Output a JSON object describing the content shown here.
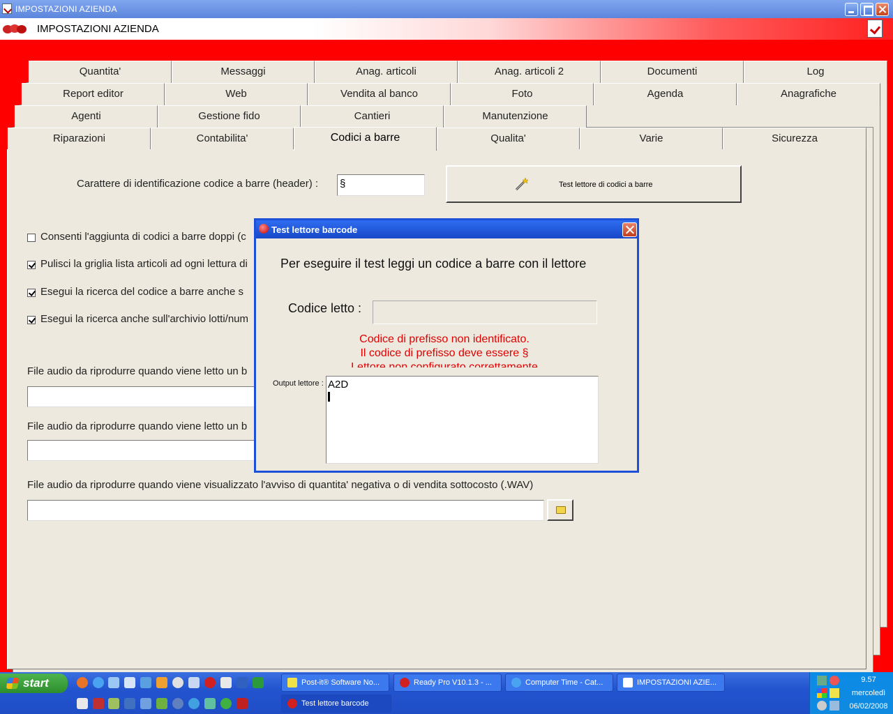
{
  "window": {
    "title": "IMPOSTAZIONI AZIENDA"
  },
  "header": {
    "title": "IMPOSTAZIONI AZIENDA"
  },
  "tabs": {
    "row1": [
      "Quantita'",
      "Messaggi",
      "Anag. articoli",
      "Anag. articoli 2",
      "Documenti",
      "Log"
    ],
    "row2": [
      "Report editor",
      "Web",
      "Vendita al banco",
      "Foto",
      "Agenda",
      "Anagrafiche"
    ],
    "row3": [
      "Agenti",
      "Gestione fido",
      "Cantieri",
      "Manutenzione"
    ],
    "row4": [
      "Riparazioni",
      "Contabilita'",
      "Codici a barre",
      "Qualita'",
      "Varie",
      "Sicurezza"
    ],
    "active": "Codici a barre"
  },
  "form": {
    "header_label": "Carattere di identificazione codice a barre (header) :",
    "header_value": "§",
    "test_button": "Test lettore di codici a barre",
    "checks": [
      {
        "label": "Consenti l'aggiunta di codici a barre doppi (c",
        "checked": false
      },
      {
        "label": "Pulisci la griglia lista articoli ad ogni lettura di",
        "checked": true
      },
      {
        "label": "Esegui la ricerca del codice a barre anche s",
        "checked": true
      },
      {
        "label": "Esegui la ricerca anche sull'archivio lotti/num",
        "checked": true
      }
    ],
    "audio1_label": "File audio da riprodurre quando viene letto un b",
    "audio2_label": "File audio da riprodurre quando viene letto un b",
    "audio3_label": "File audio da riprodurre quando viene visualizzato l'avviso di quantita' negativa o di vendita sottocosto (.WAV)",
    "audio1_value": "",
    "audio2_value": "",
    "audio3_value": ""
  },
  "dialog": {
    "title": "Test lettore barcode",
    "instruction": "Per eseguire il test leggi un codice a barre con il lettore",
    "codice_label": "Codice letto :",
    "codice_value": "",
    "errors": [
      "Codice di prefisso non identificato.",
      "Il codice di prefisso deve essere §",
      "Lettore non configurato correttamente"
    ],
    "output_label": "Output lettore :",
    "output_value": "A2D"
  },
  "taskbar": {
    "start": "start",
    "tasks": [
      "Post-it® Software No...",
      "Ready Pro V10.1.3 - ...",
      "Computer Time - Cat...",
      "IMPOSTAZIONI AZIE...",
      "Test lettore barcode"
    ],
    "clock": {
      "time": "9.57",
      "day": "mercoledì",
      "date": "06/02/2008"
    }
  },
  "colors": {
    "background": "#ff0000",
    "panel": "#ede9df",
    "dialog_border": "#1d50d8",
    "error_text": "#e00000"
  }
}
